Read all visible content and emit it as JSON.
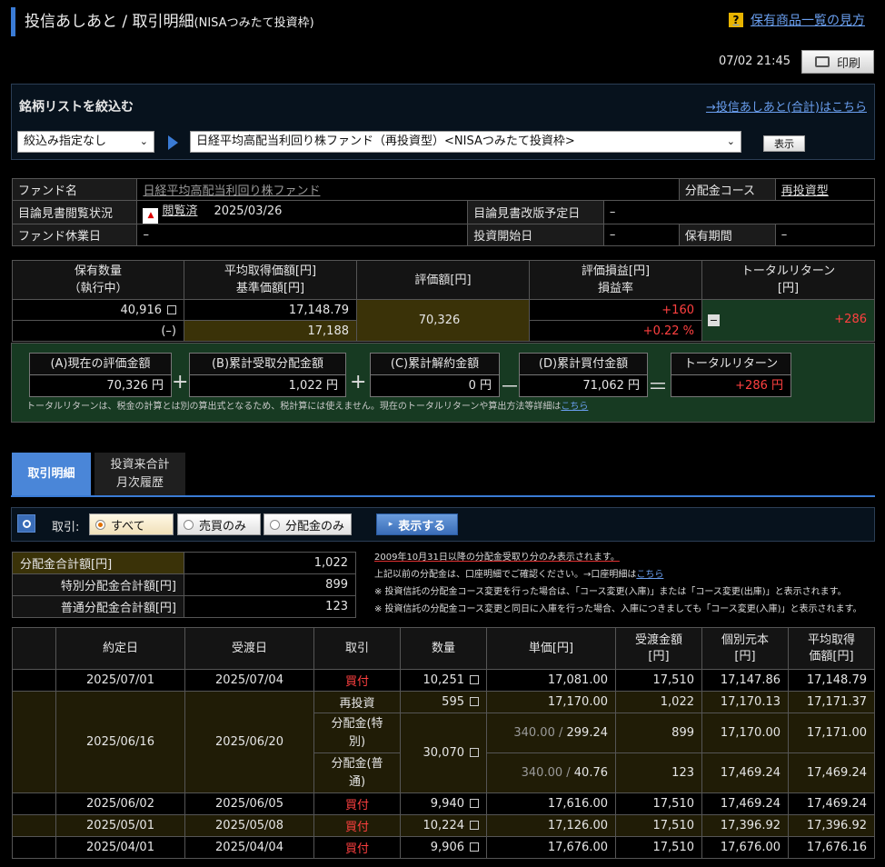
{
  "header": {
    "title_main": "投信あしあと / 取引明細",
    "title_sub": "(NISAつみたて投資枠)",
    "help_link": "保有商品一覧の見方",
    "help_icon": "question-icon",
    "datetime": "07/02 21:45",
    "print_label": "印刷"
  },
  "filter": {
    "title": "銘柄リストを絞込む",
    "total_link": "→投信あしあと(合計)はこちら",
    "narrow_value": "絞込み指定なし",
    "fund_value": "日経平均高配当利回り株ファンド（再投資型）<NISAつみたて投資枠>",
    "show_label": "表示"
  },
  "fund_info": {
    "fund_name_label": "ファンド名",
    "fund_name": "日経平均高配当利回り株ファンド",
    "course_label": "分配金コース",
    "course": "再投資型",
    "prospectus_label": "目論見書閲覧状況",
    "prospectus_status": "閲覧済",
    "prospectus_date": "2025/03/26",
    "revision_label": "目論見書改版予定日",
    "revision": "–",
    "holiday_label": "ファンド休業日",
    "holiday": "–",
    "start_label": "投資開始日",
    "start": "–",
    "period_label": "保有期間",
    "period": "–"
  },
  "position": {
    "h_qty": "保有数量",
    "h_qty2": "（執行中）",
    "h_avg": "平均取得価額[円]",
    "h_avg2": "基準価額[円]",
    "h_eval": "評価額[円]",
    "h_pl": "評価損益[円]",
    "h_pl2": "損益率",
    "h_tr": "トータルリターン",
    "h_tr2": "[円]",
    "qty": "40,916",
    "qty_exec": "(–)",
    "avg_price": "17,148.79",
    "base_price": "17,188",
    "eval": "70,326",
    "pl": "+160",
    "pl_rate": "+0.22 %",
    "total_return": "+286",
    "collapse_icon": "minus-icon"
  },
  "summary": {
    "a_label": "(A)現在の評価金額",
    "a_value": "70,326 円",
    "b_label": "(B)累計受取分配金額",
    "b_value": "1,022 円",
    "c_label": "(C)累計解約金額",
    "c_value": "0 円",
    "d_label": "(D)累計買付金額",
    "d_value": "71,062 円",
    "tr_label": "トータルリターン",
    "tr_value": "+286 円",
    "op_plus": "+",
    "op_minus": "－",
    "op_eq": "＝",
    "note": "トータルリターンは、税金の計算とは別の算出式となるため、税計算には使えません。現在のトータルリターンや算出方法等詳細は",
    "note_link": "こちら"
  },
  "tabs": {
    "tab1": "取引明細",
    "tab2_l1": "投資来合計",
    "tab2_l2": "月次履歴"
  },
  "trade_filter": {
    "label": "取引:",
    "opt_all": "すべて",
    "opt_trade": "売買のみ",
    "opt_dist": "分配金のみ",
    "display_label": "表示する",
    "search_icon": "search-icon"
  },
  "dist_totals": {
    "total_label": "分配金合計額[円]",
    "total": "1,022",
    "special_label": "特別分配金合計額[円]",
    "special": "899",
    "normal_label": "普通分配金合計額[円]",
    "normal": "123"
  },
  "notes": {
    "n1": "2009年10月31日以降の分配金受取り分のみ表示されます。",
    "n2": "上記以前の分配金は、口座明細でご確認ください。→口座明細は",
    "n2_link": "こちら",
    "n3": "※ 投資信託の分配金コース変更を行った場合は、「コース変更(入庫)」または「コース変更(出庫)」と表示されます。",
    "n4": "※ 投資信託の分配金コース変更と同日に入庫を行った場合、入庫につきましても「コース変更(入庫)」と表示されます。"
  },
  "history": {
    "headers": {
      "contract": "約定日",
      "settle": "受渡日",
      "trade": "取引",
      "qty": "数量",
      "unit_l1": "単価[円]",
      "amount_l1": "受渡金額",
      "amount_l2": "[円]",
      "principal_l1": "個別元本",
      "principal_l2": "[円]",
      "avg_l1": "平均取得",
      "avg_l2": "価額[円]"
    },
    "r1": {
      "contract": "2025/07/01",
      "settle": "2025/07/04",
      "trade": "買付",
      "qty": "10,251",
      "unit": "17,081.00",
      "amount": "17,510",
      "principal": "17,147.86",
      "avg": "17,148.79"
    },
    "g": {
      "contract": "2025/06/16",
      "settle": "2025/06/20",
      "a_trade": "再投資",
      "a_qty": "595",
      "a_unit": "17,170.00",
      "a_amount": "1,022",
      "a_principal": "17,170.13",
      "a_avg": "17,171.37",
      "b_trade": "分配金(特別)",
      "b_qty": "30,070",
      "b_unit_pre": "340.00 /",
      "b_unit": "299.24",
      "b_amount": "899",
      "b_principal": "17,170.00",
      "b_avg": "17,171.00",
      "c_trade": "分配金(普通)",
      "c_unit_pre": "340.00 /",
      "c_unit": "40.76",
      "c_amount": "123",
      "c_principal": "17,469.24",
      "c_avg": "17,469.24"
    },
    "r3": {
      "contract": "2025/06/02",
      "settle": "2025/06/05",
      "trade": "買付",
      "qty": "9,940",
      "unit": "17,616.00",
      "amount": "17,510",
      "principal": "17,469.24",
      "avg": "17,469.24"
    },
    "r4": {
      "contract": "2025/05/01",
      "settle": "2025/05/08",
      "trade": "買付",
      "qty": "10,224",
      "unit": "17,126.00",
      "amount": "17,510",
      "principal": "17,396.92",
      "avg": "17,396.92"
    },
    "r5": {
      "contract": "2025/04/01",
      "settle": "2025/04/04",
      "trade": "買付",
      "qty": "9,906",
      "unit": "17,676.00",
      "amount": "17,510",
      "principal": "17,676.00",
      "avg": "17,676.16"
    }
  }
}
